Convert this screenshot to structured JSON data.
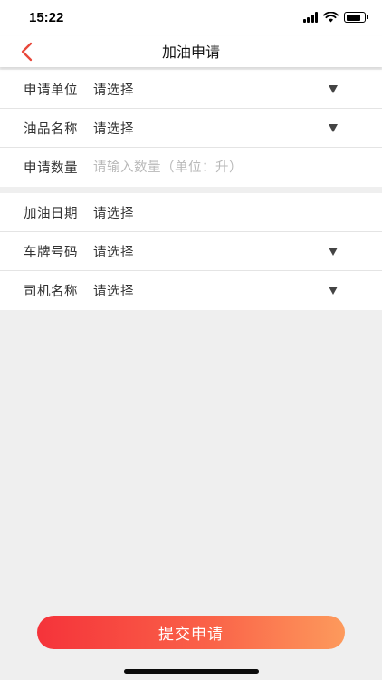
{
  "status_bar": {
    "time": "15:22"
  },
  "nav": {
    "title": "加油申请",
    "accent_color": "#e8473a"
  },
  "section1": {
    "rows": [
      {
        "label": "申请单位",
        "value": "请选择",
        "type": "select"
      },
      {
        "label": "油品名称",
        "value": "请选择",
        "type": "select"
      },
      {
        "label": "申请数量",
        "placeholder": "请输入数量（单位：升）",
        "type": "input"
      }
    ]
  },
  "section2": {
    "rows": [
      {
        "label": "加油日期",
        "value": "请选择",
        "type": "date"
      },
      {
        "label": "车牌号码",
        "value": "请选择",
        "type": "select"
      },
      {
        "label": "司机名称",
        "value": "请选择",
        "type": "select"
      }
    ]
  },
  "submit": {
    "label": "提交申请"
  }
}
